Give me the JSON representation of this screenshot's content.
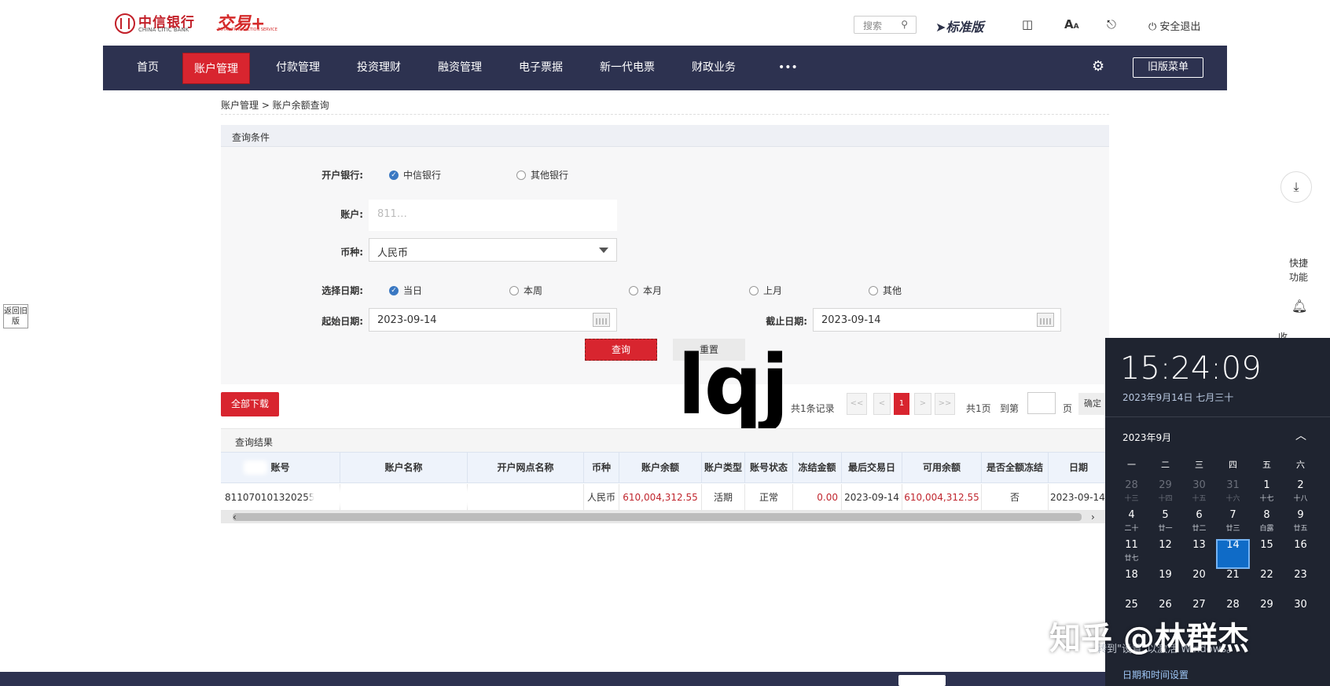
{
  "header": {
    "bank_name": "中信银行",
    "bank_name_en": "CHINA CITIC BANK",
    "product": "交易+",
    "product_sub": "TOTAL TRANSACTION SERVICE",
    "search_label": "搜索",
    "edition": "标准版",
    "logout": "安全退出"
  },
  "nav": {
    "items": [
      "首页",
      "账户管理",
      "付款管理",
      "投资理财",
      "融资管理",
      "电子票据",
      "新一代电票",
      "财政业务",
      "•••"
    ],
    "old_menu": "旧版菜单"
  },
  "breadcrumb": "账户管理 > 账户余额查询",
  "query": {
    "title": "查询条件",
    "bank_label": "开户银行:",
    "bank_options": [
      "中信银行",
      "其他银行"
    ],
    "account_label": "账户:",
    "account_value": "811…",
    "currency_label": "币种:",
    "currency_value": "人民币",
    "date_select_label": "选择日期:",
    "date_options": [
      "当日",
      "本周",
      "本月",
      "上月",
      "其他"
    ],
    "start_label": "起始日期:",
    "start_value": "2023-09-14",
    "end_label": "截止日期:",
    "end_value": "2023-09-14",
    "query_btn": "查询",
    "reset_btn": "重置"
  },
  "download_btn": "全部下载",
  "pagination": {
    "total": "共1条记录",
    "first": "<<",
    "prev": "<",
    "current": "1",
    "next": ">",
    "last": ">>",
    "pages": "共1页",
    "goto": "到第",
    "page": "页",
    "ok": "确定"
  },
  "watermark": "lqj",
  "results": {
    "title": "查询结果",
    "columns": [
      "账号",
      "账户名称",
      "开户网点名称",
      "币种",
      "账户余额",
      "账户类型",
      "账号状态",
      "冻结金额",
      "最后交易日",
      "可用余额",
      "是否全额冻结",
      "日期"
    ],
    "row": [
      "811070101320255…",
      "",
      "",
      "人民币",
      "610,004,312.55",
      "活期",
      "正常",
      "0.00",
      "2023-09-14",
      "610,004,312.55",
      "否",
      "2023-09-14"
    ]
  },
  "side": {
    "return_old": "返回旧版",
    "quick_func": "快捷功能",
    "collect": "收"
  },
  "clock": {
    "time": "15:24:09",
    "date": "2023年9月14日 七月三十",
    "month": "2023年9月",
    "weekdays": [
      "一",
      "二",
      "三",
      "四",
      "五",
      "六"
    ],
    "rows": [
      [
        [
          "28",
          "十三"
        ],
        [
          "29",
          "十四"
        ],
        [
          "30",
          "十五"
        ],
        [
          "31",
          "十六"
        ],
        [
          "1",
          "十七"
        ],
        [
          "2",
          "十八"
        ]
      ],
      [
        [
          "4",
          "二十"
        ],
        [
          "5",
          "廿一"
        ],
        [
          "6",
          "廿二"
        ],
        [
          "7",
          "廿三"
        ],
        [
          "8",
          "白露"
        ],
        [
          "9",
          "廿五"
        ]
      ],
      [
        [
          "11",
          "廿七"
        ],
        [
          "12",
          ""
        ],
        [
          "13",
          ""
        ],
        [
          "14",
          ""
        ],
        [
          "15",
          ""
        ],
        [
          "16",
          ""
        ]
      ],
      [
        [
          "18",
          ""
        ],
        [
          "19",
          ""
        ],
        [
          "20",
          ""
        ],
        [
          "21",
          ""
        ],
        [
          "22",
          ""
        ],
        [
          "23",
          ""
        ]
      ],
      [
        [
          "25",
          ""
        ],
        [
          "26",
          ""
        ],
        [
          "27",
          ""
        ],
        [
          "28",
          ""
        ],
        [
          "29",
          ""
        ],
        [
          "30",
          ""
        ]
      ]
    ],
    "settings": "日期和时间设置",
    "win_hint": "转到\"设置\"以激活 Windows。"
  },
  "overlay": "知乎 @林群杰"
}
